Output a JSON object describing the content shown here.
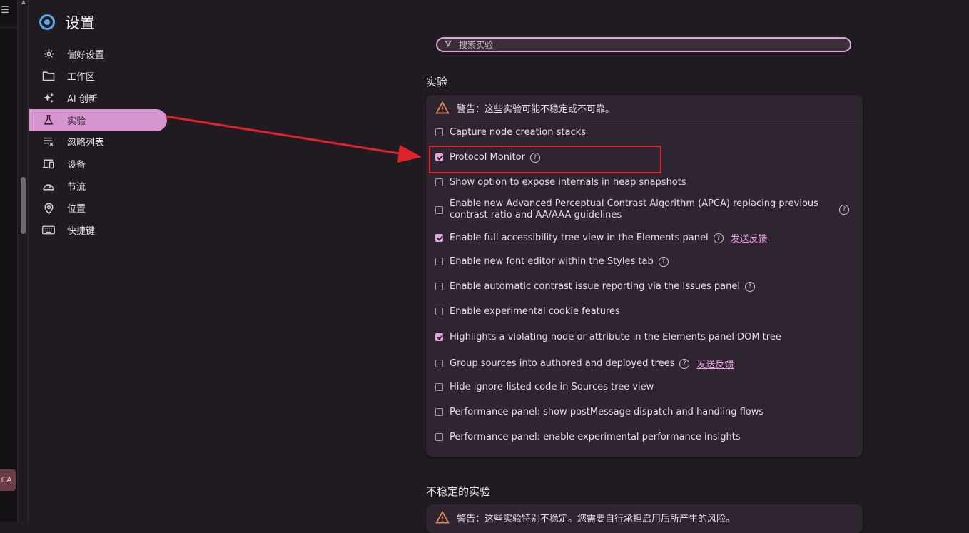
{
  "sidebar": {
    "title": "设置",
    "items": [
      {
        "label": "偏好设置",
        "icon": "gear-icon"
      },
      {
        "label": "工作区",
        "icon": "folder-icon"
      },
      {
        "label": "AI 创新",
        "icon": "sparkle-icon"
      },
      {
        "label": "实验",
        "icon": "flask-icon"
      },
      {
        "label": "忽略列表",
        "icon": "ignore-list-icon"
      },
      {
        "label": "设备",
        "icon": "devices-icon"
      },
      {
        "label": "节流",
        "icon": "speedometer-icon"
      },
      {
        "label": "位置",
        "icon": "location-pin-icon"
      },
      {
        "label": "快捷键",
        "icon": "keyboard-icon"
      }
    ],
    "active_index": 3
  },
  "search": {
    "placeholder": "搜索实验"
  },
  "experiments": {
    "title": "实验",
    "warning": "警告：这些实验可能不稳定或不可靠。",
    "items": [
      {
        "label": "Capture node creation stacks",
        "checked": false,
        "help": false,
        "feedback": ""
      },
      {
        "label": "Protocol Monitor",
        "checked": true,
        "help": true,
        "feedback": ""
      },
      {
        "label": "Show option to expose internals in heap snapshots",
        "checked": false,
        "help": false,
        "feedback": ""
      },
      {
        "label": "Enable new Advanced Perceptual Contrast Algorithm (APCA) replacing previous",
        "label2": "contrast ratio and AA/AAA guidelines",
        "checked": false,
        "help": true,
        "feedback": ""
      },
      {
        "label": "Enable full accessibility tree view in the Elements panel",
        "checked": true,
        "help": true,
        "feedback": "发送反馈"
      },
      {
        "label": "Enable new font editor within the Styles tab",
        "checked": false,
        "help": true,
        "feedback": ""
      },
      {
        "label": "Enable automatic contrast issue reporting via the Issues panel",
        "checked": false,
        "help": true,
        "feedback": ""
      },
      {
        "label": "Enable experimental cookie features",
        "checked": false,
        "help": false,
        "feedback": ""
      },
      {
        "label": "Highlights a violating node or attribute in the Elements panel DOM tree",
        "checked": true,
        "help": false,
        "feedback": ""
      },
      {
        "label": "Group sources into authored and deployed trees",
        "checked": false,
        "help": true,
        "feedback": "发送反馈"
      },
      {
        "label": "Hide ignore-listed code in Sources tree view",
        "checked": false,
        "help": false,
        "feedback": ""
      },
      {
        "label": "Performance panel: show postMessage dispatch and handling flows",
        "checked": false,
        "help": false,
        "feedback": ""
      },
      {
        "label": "Performance panel: enable experimental performance insights",
        "checked": false,
        "help": false,
        "feedback": ""
      }
    ]
  },
  "unstable": {
    "title": "不稳定的实验",
    "warning": "警告：这些实验特别不稳定。您需要自行承担启用后所产生的风险。"
  },
  "left_strip": {
    "badge": "CA"
  },
  "colors": {
    "accent": "#d795cf",
    "annotation": "#e0232b",
    "background": "#1f1b20",
    "card": "#2e2530"
  }
}
